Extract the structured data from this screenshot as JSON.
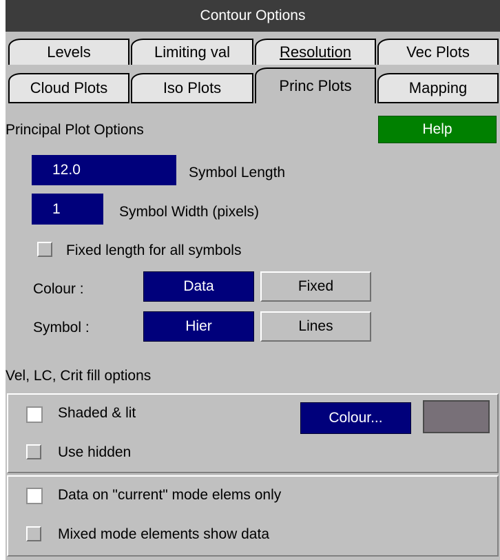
{
  "title": "Contour Options",
  "tabs": {
    "row1": [
      "Levels",
      "Limiting val",
      "Resolution",
      "Vec Plots"
    ],
    "row2": [
      "Cloud Plots",
      "Iso Plots",
      "Princ Plots",
      "Mapping"
    ],
    "active": "Princ Plots"
  },
  "principal": {
    "heading": "Principal Plot Options",
    "help_label": "Help",
    "symbol_length_value": "12.0",
    "symbol_length_label": "Symbol Length",
    "symbol_width_value": "1",
    "symbol_width_label": "Symbol Width (pixels)",
    "fixed_length_label": "Fixed length for all symbols",
    "fixed_length_checked": false,
    "colour_label": "Colour :",
    "colour_options": [
      "Data",
      "Fixed"
    ],
    "colour_selected": "Data",
    "symbol_label": "Symbol :",
    "symbol_options": [
      "Hier",
      "Lines"
    ],
    "symbol_selected": "Hier"
  },
  "fill": {
    "heading": "Vel, LC, Crit fill options",
    "shaded_lit_label": "Shaded & lit",
    "shaded_lit_checked": false,
    "use_hidden_label": "Use hidden",
    "use_hidden_checked": false,
    "colour_button_label": "Colour...",
    "swatch_color": "#787078"
  },
  "mode": {
    "current_mode_label": "Data on \"current\" mode elems only",
    "current_mode_checked": false,
    "mixed_mode_label": "Mixed mode elements show data",
    "mixed_mode_checked": false
  },
  "colors": {
    "panel_bg": "#c0c0c0",
    "title_bg": "#3c3c3c",
    "selected_blue": "#00007b",
    "help_green": "#008000"
  }
}
